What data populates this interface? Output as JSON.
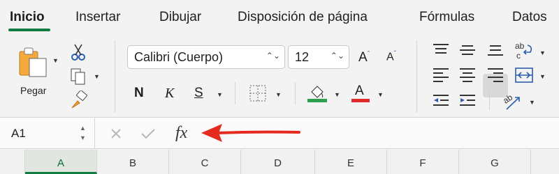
{
  "tabs": [
    {
      "label": "Inicio",
      "active": true
    },
    {
      "label": "Insertar"
    },
    {
      "label": "Dibujar"
    },
    {
      "label": "Disposición de página"
    },
    {
      "label": "Fórmulas"
    },
    {
      "label": "Datos"
    }
  ],
  "clipboard": {
    "paste_label": "Pegar"
  },
  "font": {
    "name": "Calibri (Cuerpo)",
    "size": "12",
    "grow_label": "A",
    "shrink_label": "A"
  },
  "format": {
    "bold": "N",
    "italic": "K",
    "underline": "S"
  },
  "font_color_glyph": "A",
  "colors": {
    "accent": "#107c41",
    "fill_color": "#2e9e4f",
    "font_color": "#e02b2b",
    "annotation_arrow": "#e52a20"
  },
  "formula_bar": {
    "name_box": "A1",
    "fx_label": "fx",
    "formula_value": ""
  },
  "columns": [
    "A",
    "B",
    "C",
    "D",
    "E",
    "F",
    "G"
  ],
  "selected_column": "A",
  "icons": [
    "paste-icon",
    "scissors-icon",
    "copy-icon",
    "format-painter-icon",
    "borders-icon",
    "fill-color-icon",
    "align-top-icon",
    "align-middle-icon",
    "align-bottom-icon",
    "wrap-text-icon",
    "align-left-icon",
    "align-center-icon",
    "align-right-icon",
    "merge-center-icon",
    "decrease-indent-icon",
    "increase-indent-icon",
    "orientation-icon",
    "cancel-icon",
    "enter-icon"
  ]
}
